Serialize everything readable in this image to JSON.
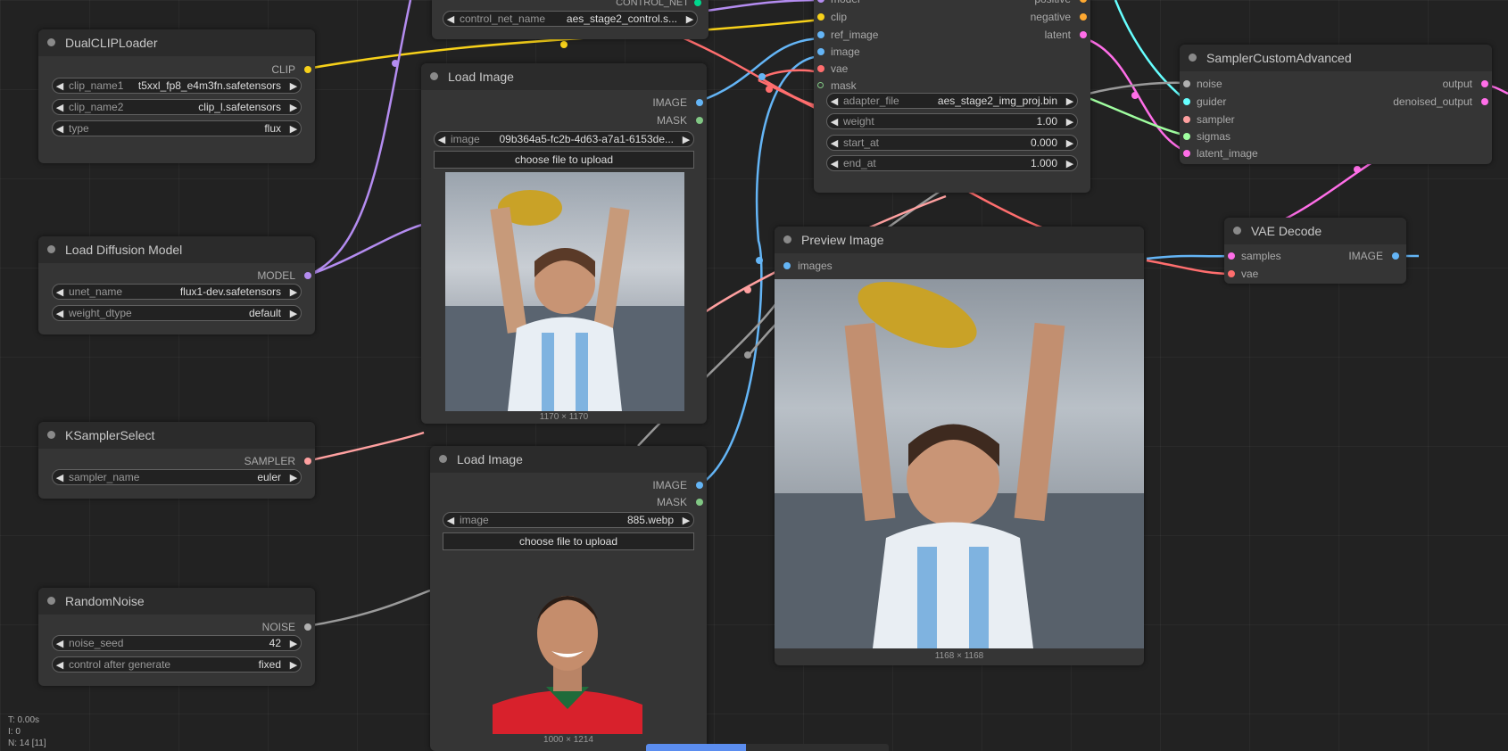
{
  "colors": {
    "clip": "#f7d11a",
    "model": "#b48cf0",
    "image": "#64b5f6",
    "mask": "#81c784",
    "vae": "#ff6e6e",
    "latent": "#ff6ee8",
    "conditioning": "#ffa931",
    "noise": "#b0b0b0",
    "sampler": "#ffa0a0",
    "guider": "#66ffff",
    "sigmas": "#a0ffa0",
    "control_net": "#00d78d"
  },
  "nodes": {
    "dualcliploader": {
      "title": "DualCLIPLoader",
      "out_clip": "CLIP",
      "w1_name": "clip_name1",
      "w1_val": "t5xxl_fp8_e4m3fn.safetensors",
      "w2_name": "clip_name2",
      "w2_val": "clip_l.safetensors",
      "w3_name": "type",
      "w3_val": "flux"
    },
    "diffusion": {
      "title": "Load Diffusion Model",
      "out_model": "MODEL",
      "w1_name": "unet_name",
      "w1_val": "flux1-dev.safetensors",
      "w2_name": "weight_dtype",
      "w2_val": "default"
    },
    "ksampler": {
      "title": "KSamplerSelect",
      "out_sampler": "SAMPLER",
      "w1_name": "sampler_name",
      "w1_val": "euler"
    },
    "noise": {
      "title": "RandomNoise",
      "out_noise": "NOISE",
      "w1_name": "noise_seed",
      "w1_val": "42",
      "w2_name": "control after generate",
      "w2_val": "fixed"
    },
    "controlnet": {
      "out_label": "CONTROL_NET",
      "w1_name": "control_net_name",
      "w1_val": "aes_stage2_control.s..."
    },
    "load1": {
      "title": "Load Image",
      "out_image": "IMAGE",
      "out_mask": "MASK",
      "w1_name": "image",
      "w1_val": "09b364a5-fc2b-4d63-a7a1-6153de...",
      "upload": "choose file to upload",
      "dims": "1170 × 1170"
    },
    "load2": {
      "title": "Load Image",
      "out_image": "IMAGE",
      "out_mask": "MASK",
      "w1_name": "image",
      "w1_val": "885.webp",
      "upload": "choose file to upload",
      "dims": "1000 × 1214"
    },
    "adapter": {
      "in_model": "model",
      "in_clip": "clip",
      "in_ref": "ref_image",
      "in_image": "image",
      "in_vae": "vae",
      "in_mask": "mask",
      "out_positive": "positive",
      "out_negative": "negative",
      "out_latent": "latent",
      "w1_name": "adapter_file",
      "w1_val": "aes_stage2_img_proj.bin",
      "w2_name": "weight",
      "w2_val": "1.00",
      "w3_name": "start_at",
      "w3_val": "0.000",
      "w4_name": "end_at",
      "w4_val": "1.000"
    },
    "preview": {
      "title": "Preview Image",
      "in_images": "images",
      "dims": "1168 × 1168"
    },
    "sampler_custom": {
      "title": "SamplerCustomAdvanced",
      "in_noise": "noise",
      "in_guider": "guider",
      "in_sampler": "sampler",
      "in_sigmas": "sigmas",
      "in_latent": "latent_image",
      "out_output": "output",
      "out_denoised": "denoised_output"
    },
    "vae_decode": {
      "title": "VAE Decode",
      "in_samples": "samples",
      "in_vae": "vae",
      "out_image": "IMAGE"
    }
  },
  "stats": {
    "t": "T: 0.00s",
    "i": "I: 0",
    "n": "N: 14 [11]"
  }
}
